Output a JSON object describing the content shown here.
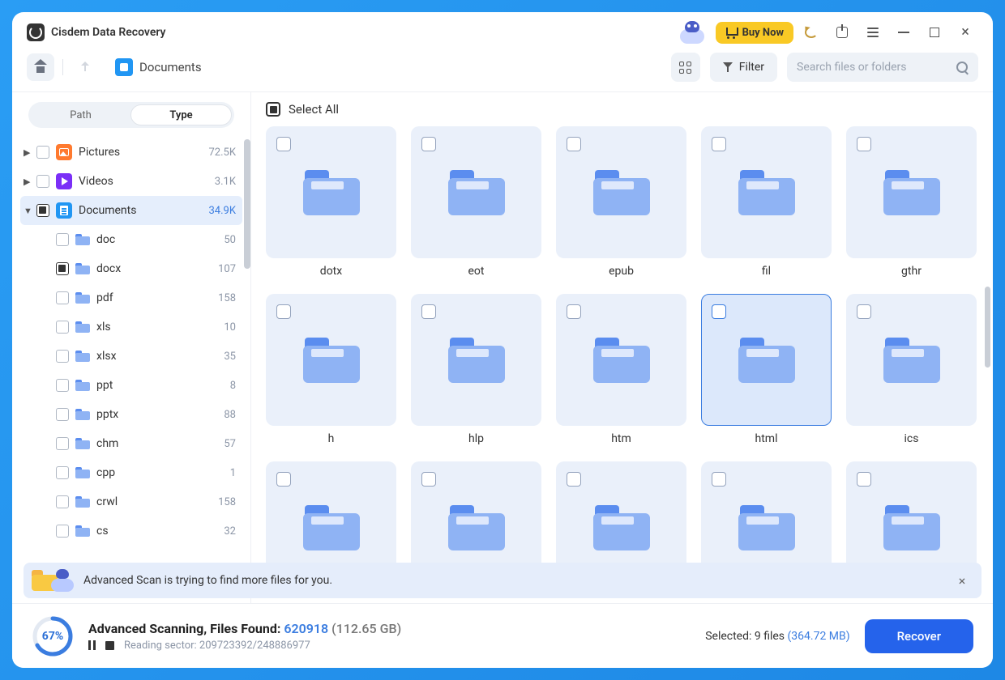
{
  "app": {
    "title": "Cisdem Data Recovery"
  },
  "titlebar": {
    "buy_label": "Buy Now"
  },
  "toolbar": {
    "breadcrumb": "Documents",
    "filter_label": "Filter",
    "search_placeholder": "Search files or folders"
  },
  "sidebar": {
    "tabs": {
      "path": "Path",
      "type": "Type"
    },
    "categories": [
      {
        "name": "Pictures",
        "count": "72.5K",
        "expanded": false,
        "checkbox": "unchecked",
        "iconClass": "cat-pictures",
        "iconInner": "pic-ic"
      },
      {
        "name": "Videos",
        "count": "3.1K",
        "expanded": false,
        "checkbox": "unchecked",
        "iconClass": "cat-videos",
        "iconInner": "play-tri"
      },
      {
        "name": "Documents",
        "count": "34.9K",
        "expanded": true,
        "checkbox": "indeterminate",
        "selected": true,
        "iconClass": "cat-documents",
        "iconInner": "doc-ic"
      }
    ],
    "doc_children": [
      {
        "name": "doc",
        "count": "50",
        "checkbox": "unchecked"
      },
      {
        "name": "docx",
        "count": "107",
        "checkbox": "indeterminate"
      },
      {
        "name": "pdf",
        "count": "158",
        "checkbox": "unchecked"
      },
      {
        "name": "xls",
        "count": "10",
        "checkbox": "unchecked"
      },
      {
        "name": "xlsx",
        "count": "35",
        "checkbox": "unchecked"
      },
      {
        "name": "ppt",
        "count": "8",
        "checkbox": "unchecked"
      },
      {
        "name": "pptx",
        "count": "88",
        "checkbox": "unchecked"
      },
      {
        "name": "chm",
        "count": "57",
        "checkbox": "unchecked"
      },
      {
        "name": "cpp",
        "count": "1",
        "checkbox": "unchecked"
      },
      {
        "name": "crwl",
        "count": "158",
        "checkbox": "unchecked"
      },
      {
        "name": "cs",
        "count": "32",
        "checkbox": "unchecked"
      }
    ]
  },
  "main": {
    "select_all_label": "Select All",
    "folders": [
      {
        "name": "dotx",
        "selected": false
      },
      {
        "name": "eot",
        "selected": false
      },
      {
        "name": "epub",
        "selected": false
      },
      {
        "name": "fil",
        "selected": false
      },
      {
        "name": "gthr",
        "selected": false
      },
      {
        "name": "h",
        "selected": false
      },
      {
        "name": "hlp",
        "selected": false
      },
      {
        "name": "htm",
        "selected": false
      },
      {
        "name": "html",
        "selected": true
      },
      {
        "name": "ics",
        "selected": false
      },
      {
        "name": "",
        "selected": false
      },
      {
        "name": "",
        "selected": false
      },
      {
        "name": "",
        "selected": false
      },
      {
        "name": "",
        "selected": false
      },
      {
        "name": "",
        "selected": false
      }
    ]
  },
  "banner": {
    "text": "Advanced Scan is trying to find more files for you."
  },
  "footer": {
    "progress_pct": "67%",
    "title_prefix": "Advanced Scanning, Files Found: ",
    "files_found": "620918",
    "total_size": " (112.65 GB)",
    "reading_label": "Reading sector: 209723392/248886977",
    "selected_prefix": "Selected: 9 files ",
    "selected_size": "(364.72 MB)",
    "recover_label": "Recover"
  }
}
